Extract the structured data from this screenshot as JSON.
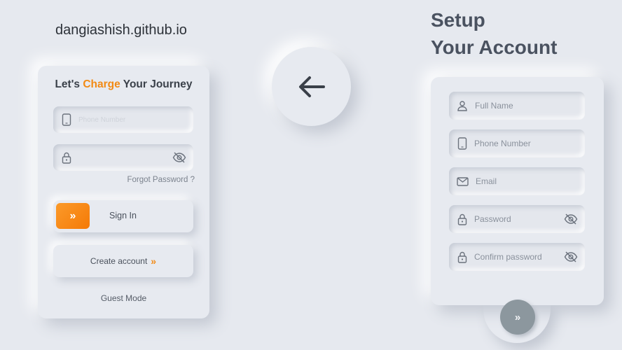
{
  "site": {
    "url": "dangiashish.github.io"
  },
  "login": {
    "title_prefix": "Let's ",
    "title_accent": "Charge",
    "title_suffix": " Your Journey",
    "phone_placeholder": "Phone Number",
    "forgot_password": "Forgot Password ?",
    "sign_in_arrow": "»",
    "sign_in_label": "Sign In",
    "create_account_label": "Create account",
    "create_account_arrow": "»",
    "guest_mode": "Guest Mode"
  },
  "back": {
    "icon": "arrow-left-icon"
  },
  "signup": {
    "title_line1": "Setup",
    "title_line2": "Your Account",
    "fields": [
      {
        "icon": "user-icon",
        "placeholder": "Full Name"
      },
      {
        "icon": "phone-icon",
        "placeholder": "Phone Number"
      },
      {
        "icon": "mail-icon",
        "placeholder": "Email"
      },
      {
        "icon": "lock-icon",
        "placeholder": "Password",
        "trailing_icon": "eye-off-icon"
      },
      {
        "icon": "lock-icon",
        "placeholder": "Confirm password",
        "trailing_icon": "eye-off-icon"
      }
    ],
    "next_arrow": "»"
  },
  "colors": {
    "background": "#e6e9ef",
    "accent_orange": "#f28a14",
    "next_button": "#8c979e",
    "text_dark": "#3a4049"
  }
}
